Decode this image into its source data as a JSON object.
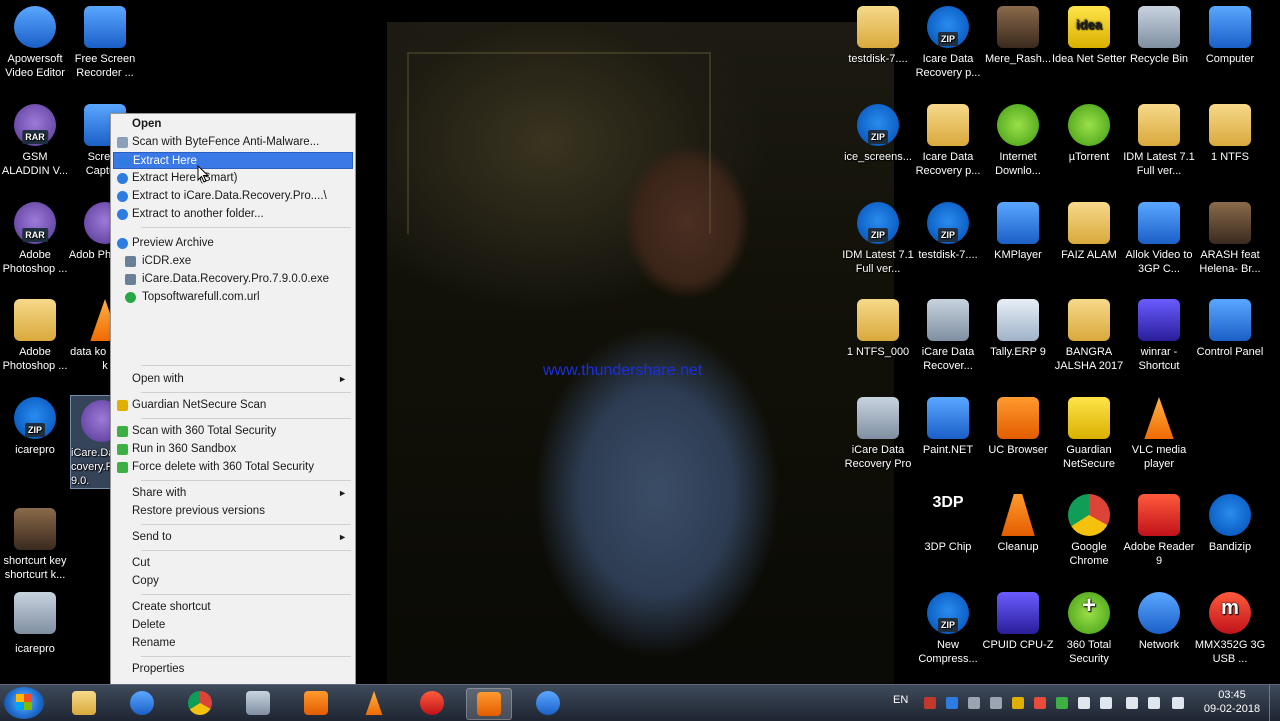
{
  "watermark": "www.thundershare.net",
  "desktop_icons": [
    {
      "id": "apowersoft",
      "label": "Apowersoft Video Editor"
    },
    {
      "id": "free-screen-recorder",
      "label": "Free Screen Recorder ..."
    },
    {
      "id": "gsm-aladdin",
      "label": "GSM ALADDIN V..."
    },
    {
      "id": "screen-capture",
      "label": "Screen Captu..."
    },
    {
      "id": "adobe-photoshop-1",
      "label": "Adobe Photoshop ..."
    },
    {
      "id": "adobe-photoshop-2",
      "label": "Adob Photos..."
    },
    {
      "id": "adobe-photoshop-3",
      "label": "Adobe Photoshop ..."
    },
    {
      "id": "data-kolor-recycle",
      "label": "data ko recyer k"
    },
    {
      "id": "icarepro-zip",
      "label": "icarepro"
    },
    {
      "id": "icare-data-recovery-selected",
      "label": "iCare.Data.Re covery.Pro.7. 9.0."
    },
    {
      "id": "shortcut-key",
      "label": "shortcurt key shortcurt k..."
    },
    {
      "id": "icarepro-box",
      "label": "icarepro"
    },
    {
      "id": "testdisk-1",
      "label": "testdisk-7...."
    },
    {
      "id": "icare-recovery-p-1",
      "label": "Icare Data Recovery p..."
    },
    {
      "id": "mere-rashke",
      "label": "Mere_Rash..."
    },
    {
      "id": "idea-net-setter",
      "label": "Idea Net Setter"
    },
    {
      "id": "recycle-bin",
      "label": "Recycle Bin"
    },
    {
      "id": "computer",
      "label": "Computer"
    },
    {
      "id": "ice-screens",
      "label": "ice_screens..."
    },
    {
      "id": "icare-recovery-p-2",
      "label": "Icare Data Recovery p..."
    },
    {
      "id": "internet-download",
      "label": "Internet Downlo..."
    },
    {
      "id": "utorrent",
      "label": "µTorrent"
    },
    {
      "id": "idm-latest-1",
      "label": "IDM Latest 7.1 Full ver..."
    },
    {
      "id": "ntfs-1",
      "label": "1 NTFS"
    },
    {
      "id": "idm-latest-2",
      "label": "IDM Latest 7.1 Full ver..."
    },
    {
      "id": "testdisk-2",
      "label": "testdisk-7...."
    },
    {
      "id": "kmplayer",
      "label": "KMPlayer"
    },
    {
      "id": "faiz-alam",
      "label": "FAIZ ALAM"
    },
    {
      "id": "allok-video",
      "label": "Allok Video to 3GP C..."
    },
    {
      "id": "arash-feat",
      "label": "ARASH feat Helena- Br..."
    },
    {
      "id": "ntfs-000",
      "label": "1 NTFS_000"
    },
    {
      "id": "icare-recover-3",
      "label": "iCare Data Recover..."
    },
    {
      "id": "tally-erp",
      "label": "Tally.ERP 9"
    },
    {
      "id": "bangra-jalsha",
      "label": "BANGRA JALSHA 2017"
    },
    {
      "id": "winrar-shortcut",
      "label": "winrar - Shortcut"
    },
    {
      "id": "control-panel",
      "label": "Control Panel"
    },
    {
      "id": "icare-data-recovery-pro",
      "label": "iCare Data Recovery Pro"
    },
    {
      "id": "paint-net",
      "label": "Paint.NET"
    },
    {
      "id": "uc-browser",
      "label": "UC Browser"
    },
    {
      "id": "guardian-netsecure",
      "label": "Guardian NetSecure"
    },
    {
      "id": "vlc",
      "label": "VLC media player"
    },
    {
      "id": "3dp-chip",
      "label": "3DP Chip"
    },
    {
      "id": "cleanup",
      "label": "Cleanup"
    },
    {
      "id": "google-chrome",
      "label": "Google Chrome"
    },
    {
      "id": "adobe-reader",
      "label": "Adobe Reader 9"
    },
    {
      "id": "bandizip",
      "label": "Bandizip"
    },
    {
      "id": "new-compressed",
      "label": "New Compress..."
    },
    {
      "id": "cpuid",
      "label": "CPUID CPU-Z"
    },
    {
      "id": "360-total-security",
      "label": "360 Total Security"
    },
    {
      "id": "network",
      "label": "Network"
    },
    {
      "id": "mmx352g",
      "label": "MMX352G 3G USB ..."
    }
  ],
  "icon_tags": {
    "zip": "ZIP",
    "rar": "RAR",
    "idea": "idea",
    "3dp": "3DP"
  },
  "context_menu": {
    "open": "Open",
    "scan_bytefence": "Scan with ByteFence Anti-Malware...",
    "extract_here": "Extract Here",
    "extract_here_smart": "Extract Here (Smart)",
    "extract_to": "Extract to iCare.Data.Recovery.Pro....\\",
    "extract_another": "Extract to another folder...",
    "preview_archive": "Preview Archive",
    "icdr_exe": "iCDR.exe",
    "icare_exe": "iCare.Data.Recovery.Pro.7.9.0.0.exe",
    "topsoftware_url": "Topsoftwarefull.com.url",
    "open_with": "Open with",
    "guardian_scan": "Guardian NetSecure Scan",
    "scan_360": "Scan with 360 Total Security",
    "run_sandbox": "Run in 360 Sandbox",
    "force_delete": "Force delete with 360 Total Security",
    "share_with": "Share with",
    "restore_versions": "Restore previous versions",
    "send_to": "Send to",
    "cut": "Cut",
    "copy": "Copy",
    "create_shortcut": "Create shortcut",
    "delete": "Delete",
    "rename": "Rename",
    "properties": "Properties",
    "submenu_arrow": "►"
  },
  "taskbar": {
    "apps": [
      "explorer-icon",
      "internet-explorer-icon",
      "chrome-icon",
      "rocket-icon",
      "media-icon",
      "vlc-icon",
      "mmx-icon",
      "uc-browser-icon",
      "apowersoft-icon"
    ],
    "language": "EN",
    "time": "03:45",
    "date": "09-02-2018"
  },
  "colors": {
    "highlight": "#3b79e6",
    "menu_bg": "#f1f1f1",
    "watermark": "#1a2fe0"
  }
}
